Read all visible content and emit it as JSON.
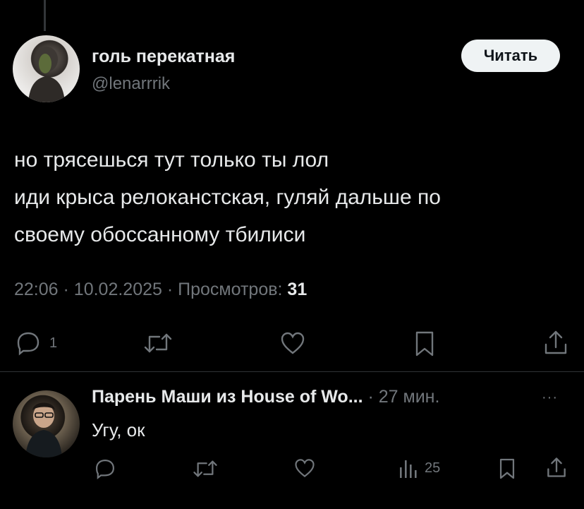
{
  "tweet": {
    "display_name": "голь перекатная",
    "handle": "@lenarrrik",
    "follow_label": "Читать",
    "lines": [
      "но трясешься тут только ты лол",
      "иди крыса релоканстская, гуляй дальше по",
      "своему обоссанному тбилиси"
    ],
    "time": "22:06",
    "date": "10.02.2025",
    "views_label": "Просмотров:",
    "views_count": "31",
    "separator": "·",
    "reply_count": "1"
  },
  "reply": {
    "display_name": "Парень Маши из House of Wo...",
    "separator": "·",
    "time": "27 мин.",
    "more": "···",
    "text": "Угу, ок",
    "views_count": "25"
  },
  "icons": {
    "reply": "reply-icon",
    "retweet": "retweet-icon",
    "like": "heart-icon",
    "bookmark": "bookmark-icon",
    "share": "share-icon",
    "views": "analytics-icon",
    "more": "more-icon"
  },
  "colors": {
    "background": "#000000",
    "text": "#e7e9ea",
    "secondary": "#71767b",
    "divider": "#2f3336",
    "button_bg": "#eff3f4"
  }
}
